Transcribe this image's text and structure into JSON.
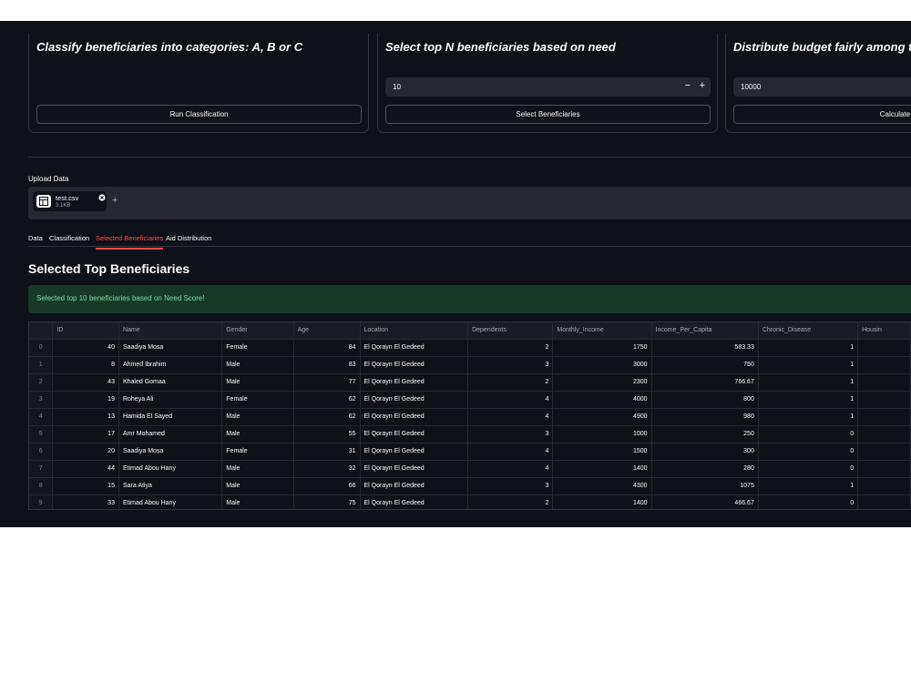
{
  "cards": [
    {
      "title": "Classify beneficiaries into categories: A, B or C",
      "button": "Run Classification"
    },
    {
      "title": "Select top N beneficiaries based on need",
      "input_value": "10",
      "button": "Select Beneficiaries"
    },
    {
      "title": "Distribute budget fairly among top b",
      "input_value": "10000",
      "button": "Calculate Distrib"
    }
  ],
  "stepper": {
    "minus": "−",
    "plus": "+"
  },
  "upload": {
    "label": "Upload Data",
    "file_name": "test.csv",
    "file_size": "3.1KB",
    "add": "+"
  },
  "tabs": [
    "Data",
    "Classification",
    "Selected Beneficiaries",
    "Aid Distribution"
  ],
  "active_tab": "Selected Beneficiaries",
  "section_title": "Selected Top Beneficiaries",
  "success_message": "Selected top 10 beneficiaries based on Need Score!",
  "table": {
    "columns": [
      "",
      "ID",
      "Name",
      "Gender",
      "Age",
      "Location",
      "Dependents",
      "Monthly_Income",
      "Income_Per_Capita",
      "Chronic_Disease",
      "Housin"
    ],
    "rows": [
      [
        "0",
        "40",
        "Saadiya Mosa",
        "Female",
        "84",
        "El Qorayn El Gedeed",
        "2",
        "1750",
        "583.33",
        "1",
        ""
      ],
      [
        "1",
        "8",
        "Ahmed Ibrahim",
        "Male",
        "83",
        "El Qorayn El Gedeed",
        "3",
        "3000",
        "750",
        "1",
        ""
      ],
      [
        "2",
        "43",
        "Khaled Gomaa",
        "Male",
        "77",
        "El Qorayn El Gedeed",
        "2",
        "2300",
        "766.67",
        "1",
        ""
      ],
      [
        "3",
        "19",
        "Roheya Ali",
        "Female",
        "62",
        "El Qorayn El Gedeed",
        "4",
        "4000",
        "800",
        "1",
        ""
      ],
      [
        "4",
        "13",
        "Hamida El Sayed",
        "Male",
        "62",
        "El Qorayn El Gedeed",
        "4",
        "4900",
        "980",
        "1",
        ""
      ],
      [
        "5",
        "17",
        "Amr Mohamed",
        "Male",
        "55",
        "El Qorayn El Gedeed",
        "3",
        "1000",
        "250",
        "0",
        ""
      ],
      [
        "6",
        "20",
        "Saadiya Mosa",
        "Female",
        "31",
        "El Qorayn El Gedeed",
        "4",
        "1500",
        "300",
        "0",
        ""
      ],
      [
        "7",
        "44",
        "Etimad Abou Hany",
        "Male",
        "32",
        "El Qorayn El Gedeed",
        "4",
        "1400",
        "280",
        "0",
        ""
      ],
      [
        "8",
        "15",
        "Sara Atiya",
        "Male",
        "66",
        "El Qorayn El Gedeed",
        "3",
        "4300",
        "1075",
        "1",
        ""
      ],
      [
        "9",
        "33",
        "Etimad Abou Hany",
        "Male",
        "75",
        "El Qorayn El Gedeed",
        "2",
        "1400",
        "466.67",
        "0",
        ""
      ]
    ]
  },
  "colors": {
    "background": "#0e1117",
    "accent": "#ff4b4b",
    "success_bg": "#173928",
    "success_text": "#7bd9a2",
    "input_bg": "#262730"
  }
}
